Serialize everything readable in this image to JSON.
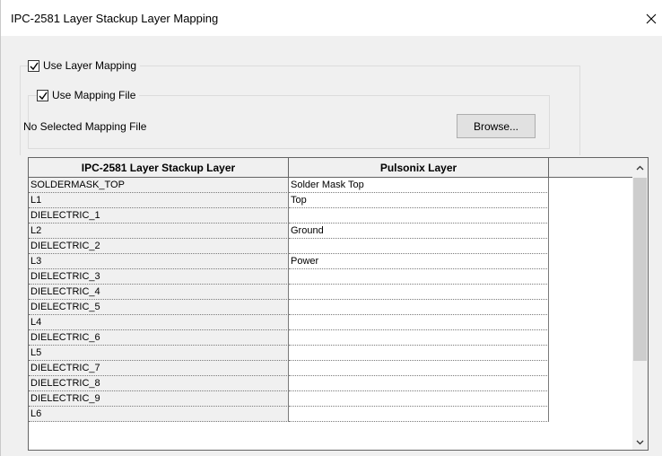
{
  "window": {
    "title": "IPC-2581 Layer Stackup Layer Mapping"
  },
  "use_layer_mapping": {
    "label": "Use Layer Mapping",
    "checked": true
  },
  "use_mapping_file": {
    "label": "Use Mapping File",
    "checked": true
  },
  "mapping_file": {
    "status_text": "No Selected Mapping File",
    "browse_label": "Browse..."
  },
  "grid": {
    "columns": [
      "IPC-2581 Layer Stackup Layer",
      "Pulsonix Layer"
    ],
    "rows": [
      {
        "layer": "SOLDERMASK_TOP",
        "pulsonix": "Solder Mask Top"
      },
      {
        "layer": "L1",
        "pulsonix": "Top"
      },
      {
        "layer": "DIELECTRIC_1",
        "pulsonix": ""
      },
      {
        "layer": "L2",
        "pulsonix": "Ground"
      },
      {
        "layer": "DIELECTRIC_2",
        "pulsonix": ""
      },
      {
        "layer": "L3",
        "pulsonix": "Power"
      },
      {
        "layer": "DIELECTRIC_3",
        "pulsonix": ""
      },
      {
        "layer": "DIELECTRIC_4",
        "pulsonix": ""
      },
      {
        "layer": "DIELECTRIC_5",
        "pulsonix": ""
      },
      {
        "layer": "L4",
        "pulsonix": ""
      },
      {
        "layer": "DIELECTRIC_6",
        "pulsonix": ""
      },
      {
        "layer": "L5",
        "pulsonix": ""
      },
      {
        "layer": "DIELECTRIC_7",
        "pulsonix": ""
      },
      {
        "layer": "DIELECTRIC_8",
        "pulsonix": ""
      },
      {
        "layer": "DIELECTRIC_9",
        "pulsonix": ""
      },
      {
        "layer": "L6",
        "pulsonix": ""
      }
    ]
  },
  "icons": {
    "close": "close-icon",
    "check": "checkmark-icon",
    "scroll_up": "chevron-up-icon",
    "scroll_down": "chevron-down-icon"
  }
}
